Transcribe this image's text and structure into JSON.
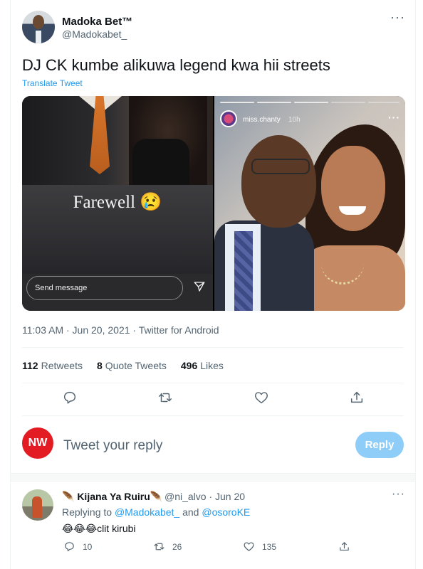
{
  "tweet": {
    "author_name": "Madoka Bet™",
    "author_handle": "@Madokabet_",
    "more": "···",
    "text": "DJ CK kumbe alikuwa legend kwa hii streets",
    "translate": "Translate Tweet",
    "media": {
      "left_story": {
        "caption": "Farewell 😢",
        "send_placeholder": "Send message"
      },
      "right_story": {
        "username": "miss.chanty",
        "time": "10h",
        "more": "···"
      }
    },
    "meta": "11:03 AM · Jun 20, 2021 · Twitter for Android",
    "stats": {
      "retweets_count": "112",
      "retweets_label": "Retweets",
      "quotes_count": "8",
      "quotes_label": "Quote Tweets",
      "likes_count": "496",
      "likes_label": "Likes"
    }
  },
  "composer": {
    "avatar_text": "NW",
    "placeholder": "Tweet your reply",
    "button": "Reply",
    "avatar_color": "#e31b23",
    "button_color": "#8ecdf8"
  },
  "reply": {
    "name": "🪶 Kijana Ya Ruiru🪶",
    "handle_date": "@ni_alvo · Jun 20",
    "more": "···",
    "replying_prefix": "Replying to",
    "replying_to_1": "@Madokabet_",
    "replying_and": "and",
    "replying_to_2": "@osoroKE",
    "text": "😂😂😂clit kirubi",
    "replies": "10",
    "retweets": "26",
    "likes": "135"
  },
  "colors": {
    "accent": "#1d9bf0",
    "secondary_text": "#536471",
    "primary_text": "#0f1419"
  },
  "icons": {
    "reply": "reply-icon",
    "retweet": "retweet-icon",
    "like": "heart-icon",
    "share": "share-icon",
    "send": "send-icon"
  }
}
